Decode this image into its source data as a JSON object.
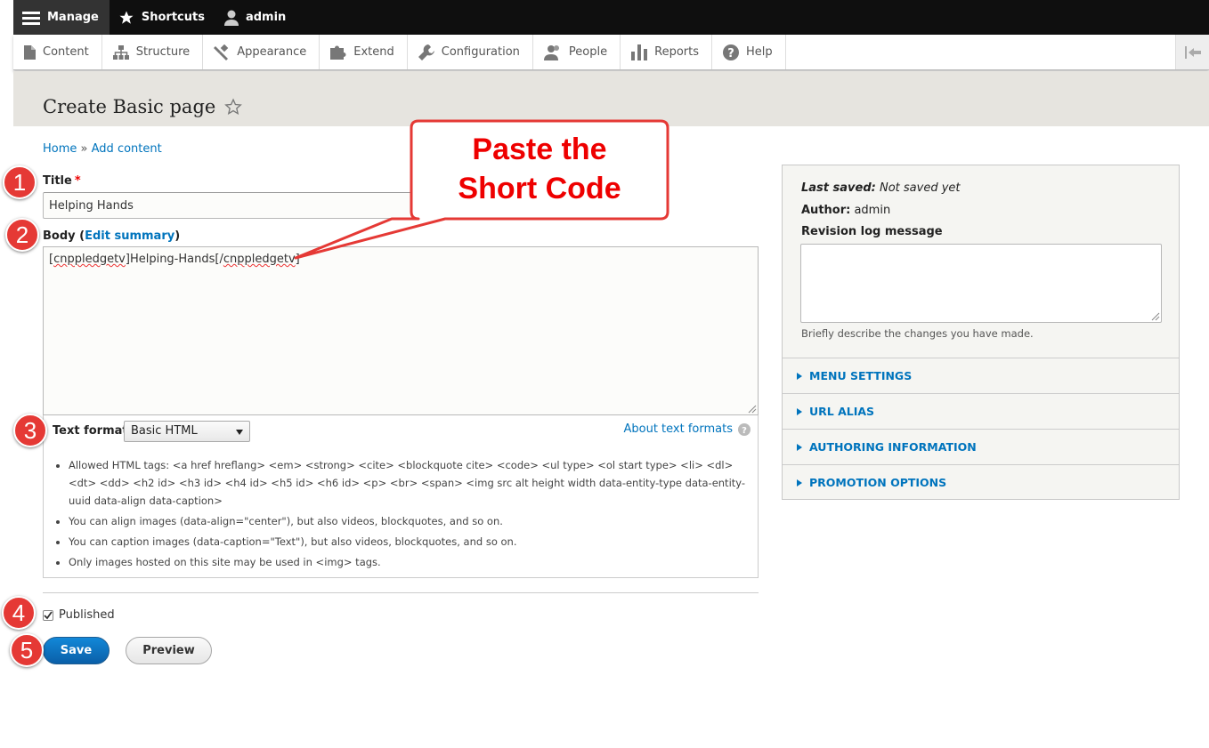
{
  "toolbar": {
    "manage": "Manage",
    "shortcuts": "Shortcuts",
    "user": "admin"
  },
  "tray": {
    "items": [
      "Content",
      "Structure",
      "Appearance",
      "Extend",
      "Configuration",
      "People",
      "Reports",
      "Help"
    ]
  },
  "page": {
    "title": "Create Basic page"
  },
  "breadcrumb": {
    "home": "Home",
    "separator": "»",
    "current": "Add content"
  },
  "form": {
    "title_label": "Title",
    "required_mark": "*",
    "title_value": "Helping Hands",
    "body_label": "Body",
    "edit_summary": "Edit summary",
    "body_value": {
      "open_bracket": "[",
      "tag_open": "cnppledgetv",
      "mid": "]Helping-Hands[/",
      "tag_close": "cnppledgetv",
      "close_bracket": "]"
    },
    "text_format_label": "Text format",
    "text_format_value": "Basic HTML",
    "about_text_formats": "About text formats",
    "tips": [
      "Allowed HTML tags: <a href hreflang> <em> <strong> <cite> <blockquote cite> <code> <ul type> <ol start type> <li> <dl> <dt> <dd> <h2 id> <h3 id> <h4 id> <h5 id> <h6 id> <p> <br> <span> <img src alt height width data-entity-type data-entity-uuid data-align data-caption>",
      "You can align images (data-align=\"center\"), but also videos, blockquotes, and so on.",
      "You can caption images (data-caption=\"Text\"), but also videos, blockquotes, and so on.",
      "Only images hosted on this site may be used in <img> tags."
    ],
    "published_label": "Published",
    "published_checked": true,
    "save_label": "Save",
    "preview_label": "Preview"
  },
  "sidebar": {
    "last_saved_label": "Last saved:",
    "last_saved_value": "Not saved yet",
    "author_label": "Author:",
    "author_value": "admin",
    "revision_label": "Revision log message",
    "revision_value": "",
    "revision_help": "Briefly describe the changes you have made.",
    "sections": [
      "MENU SETTINGS",
      "URL ALIAS",
      "AUTHORING INFORMATION",
      "PROMOTION OPTIONS"
    ]
  },
  "annotations": {
    "badges": [
      "1",
      "2",
      "3",
      "4",
      "5"
    ],
    "callout_line1": "Paste the",
    "callout_line2": "Short Code",
    "color": "#e53935"
  },
  "colors": {
    "link": "#0074bd",
    "toolbar_bg": "#0f0f0f",
    "header_bg": "#e6e4df",
    "primary_button": "#0a6fbd"
  }
}
